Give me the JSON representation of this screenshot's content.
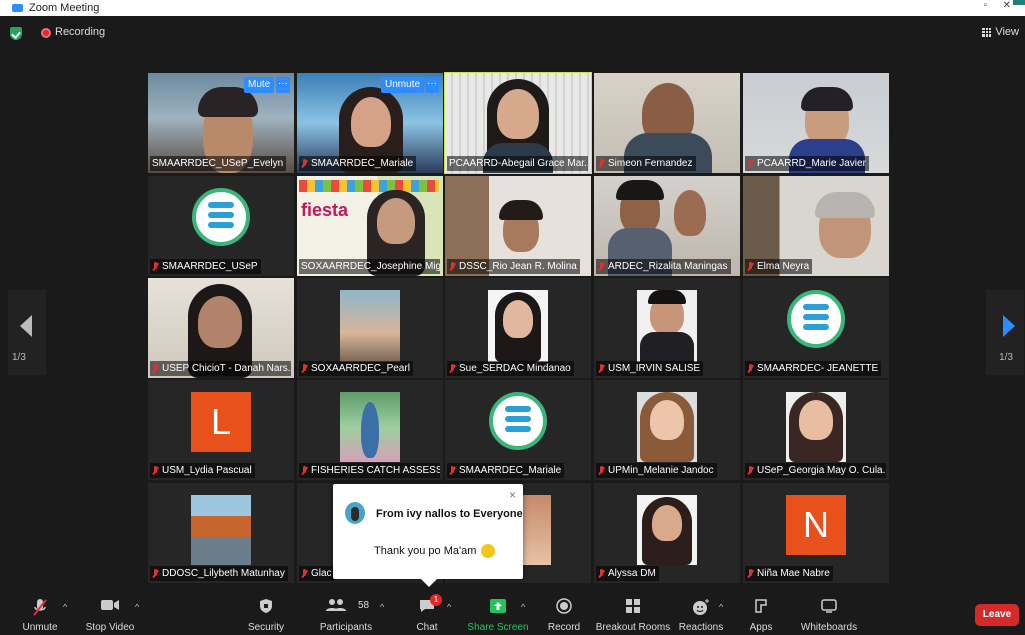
{
  "window": {
    "title": "Zoom Meeting"
  },
  "topbar": {
    "recording_label": "Recording",
    "view_label": "View"
  },
  "gallery": {
    "page_left": "1/3",
    "page_right": "1/3",
    "tiles": [
      {
        "name": "SMAARRDEC_USeP_Evelyn",
        "muted": false,
        "button": "Mute"
      },
      {
        "name": "SMAARRDEC_Mariale",
        "muted": true,
        "button": "Unmute"
      },
      {
        "name": "PCAARRD-Abegail Grace Mar...",
        "muted": false,
        "speaking": true
      },
      {
        "name": "Simeon Fernandez",
        "muted": true
      },
      {
        "name": "PCAARRD_Marie Javier",
        "muted": true
      },
      {
        "name": "SMAARRDEC_USeP",
        "muted": true
      },
      {
        "name": "SOXAARRDEC_Josephine Mig...",
        "muted": false
      },
      {
        "name": "DSSC_Rio Jean R. Molina",
        "muted": true
      },
      {
        "name": "ARDEC_Rizalita Maningas",
        "muted": true
      },
      {
        "name": "Elma Neyra",
        "muted": true
      },
      {
        "name": "USEP ChicioT - Danah Nars...",
        "muted": true
      },
      {
        "name": "SOXAARRDEC_Pearl",
        "muted": true
      },
      {
        "name": "Sue_SERDAC Mindanao",
        "muted": true
      },
      {
        "name": "USM_IRVIN SALISE",
        "muted": true
      },
      {
        "name": "SMAARRDEC- JEANETTE",
        "muted": true
      },
      {
        "name": "USM_Lydia Pascual",
        "muted": true
      },
      {
        "name": "FISHERIES CATCH ASSESSM...",
        "muted": true
      },
      {
        "name": "SMAARRDEC_Mariale",
        "muted": true
      },
      {
        "name": "UPMin_Melanie Jandoc",
        "muted": true
      },
      {
        "name": "USeP_Georgia May O. Cula...",
        "muted": true
      },
      {
        "name": "DDOSC_Lilybeth Matunhay",
        "muted": true
      },
      {
        "name": "Glac",
        "muted": true
      },
      {
        "name": "",
        "muted": false
      },
      {
        "name": "Alyssa DM",
        "muted": true
      },
      {
        "name": "Niña Mae Nabre",
        "muted": true
      }
    ],
    "letters": {
      "lydia": "L",
      "nina": "N"
    }
  },
  "chat_popup": {
    "from": "From ivy nallos to Everyone",
    "message": "Thank you po Ma'am",
    "close": "×"
  },
  "toolbar": {
    "unmute": "Unmute",
    "stop_video": "Stop Video",
    "security": "Security",
    "participants": "Participants",
    "participants_count": "58",
    "chat": "Chat",
    "chat_badge": "1",
    "share_screen": "Share Screen",
    "record": "Record",
    "breakout_rooms": "Breakout Rooms",
    "reactions": "Reactions",
    "apps": "Apps",
    "whiteboards": "Whiteboards",
    "leave": "Leave"
  },
  "colors": {
    "accent": "#2d8cff",
    "speaker_border": "#cfe24c",
    "share_green": "#23c45e",
    "leave_red": "#d42a2a"
  }
}
